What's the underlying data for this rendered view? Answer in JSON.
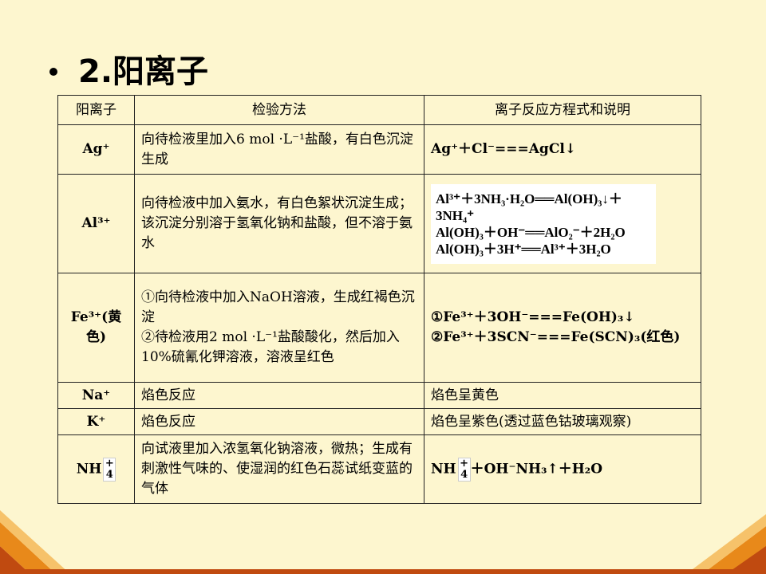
{
  "title": "2.阳离子",
  "table": {
    "headers": [
      "阳离子",
      "检验方法",
      "离子反应方程式和说明"
    ],
    "rows": [
      {
        "ion": "Ag⁺",
        "method": "向待检液里加入6 mol ·L⁻¹盐酸，有白色沉淀生成",
        "equation": "Ag⁺＋Cl⁻===AgCl↓"
      },
      {
        "ion": "Al³⁺",
        "method": "向待检液中加入氨水，有白色絮状沉淀生成；该沉淀分别溶于氢氧化钠和盐酸，但不溶于氨水",
        "equation_lines": [
          "Al³⁺＋3NH₃·H₂O══Al(OH)₃↓＋3NH₄⁺",
          "Al(OH)₃＋OH⁻══AlO₂⁻＋2H₂O",
          "Al(OH)₃＋3H⁺══Al³⁺＋3H₂O"
        ]
      },
      {
        "ion": "Fe³⁺(黄色)",
        "method_lines": [
          "①向待检液中加入NaOH溶液，生成红褐色沉淀",
          "②待检液用2 mol ·L⁻¹盐酸酸化，然后加入10%硫氰化钾溶液，溶液呈红色"
        ],
        "equation_lines": [
          "①Fe³⁺＋3OH⁻===Fe(OH)₃↓",
          "②Fe³⁺＋3SCN⁻===Fe(SCN)₃(红色)"
        ]
      },
      {
        "ion": "Na⁺",
        "method": "焰色反应",
        "equation": "焰色呈黄色"
      },
      {
        "ion": "K⁺",
        "method": "焰色反应",
        "equation": "焰色呈紫色(透过蓝色钴玻璃观察)"
      },
      {
        "ion_prefix": "NH",
        "ion_box": "+\n4",
        "method": "向试液里加入浓氢氧化钠溶液，微热；生成有刺激性气味的、使湿润的红色石蕊试纸变蓝的气体",
        "equation_prefix": "NH",
        "equation_box": "+\n4",
        "equation_rest": "＋OH⁻NH₃↑＋H₂O"
      }
    ]
  },
  "colors": {
    "background": "#fdf6cf",
    "deco_orange": "#e8891a",
    "deco_dark": "#c04a10",
    "deco_light": "#f6c26a"
  }
}
